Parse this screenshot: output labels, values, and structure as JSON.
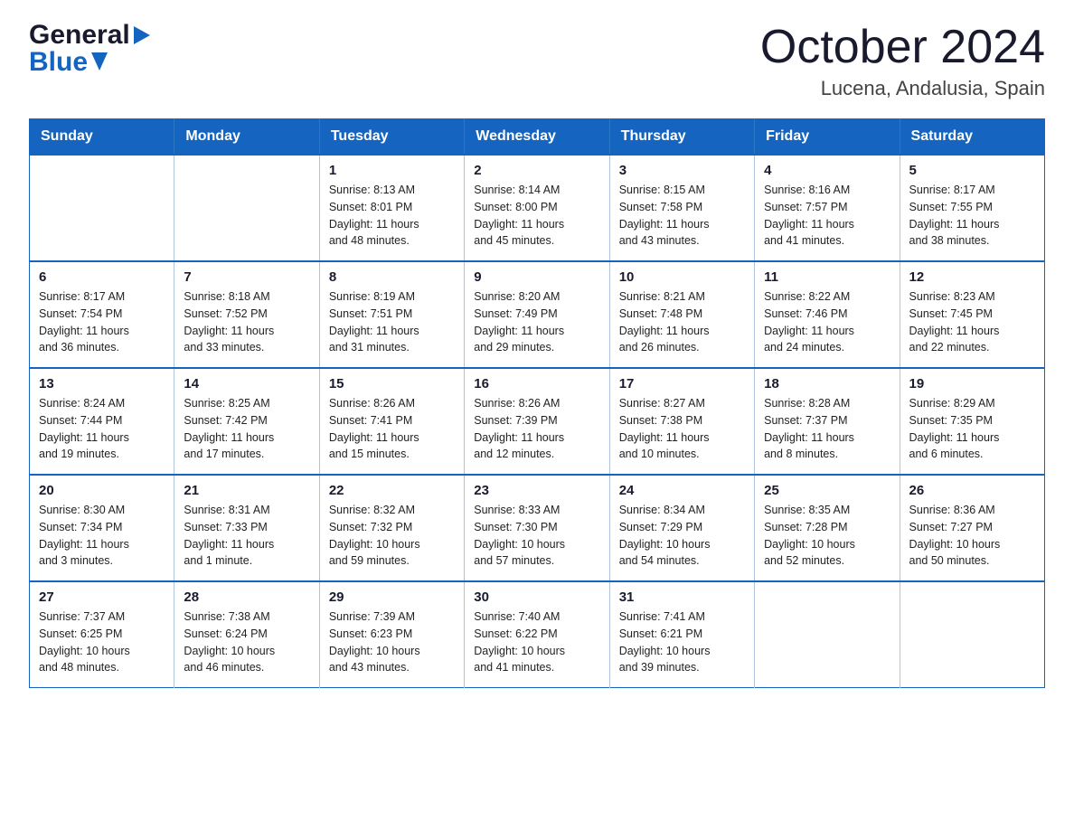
{
  "header": {
    "logo_general": "General",
    "logo_blue": "Blue",
    "month_title": "October 2024",
    "location": "Lucena, Andalusia, Spain"
  },
  "calendar": {
    "days_of_week": [
      "Sunday",
      "Monday",
      "Tuesday",
      "Wednesday",
      "Thursday",
      "Friday",
      "Saturday"
    ],
    "weeks": [
      [
        {
          "day": "",
          "info": ""
        },
        {
          "day": "",
          "info": ""
        },
        {
          "day": "1",
          "info": "Sunrise: 8:13 AM\nSunset: 8:01 PM\nDaylight: 11 hours\nand 48 minutes."
        },
        {
          "day": "2",
          "info": "Sunrise: 8:14 AM\nSunset: 8:00 PM\nDaylight: 11 hours\nand 45 minutes."
        },
        {
          "day": "3",
          "info": "Sunrise: 8:15 AM\nSunset: 7:58 PM\nDaylight: 11 hours\nand 43 minutes."
        },
        {
          "day": "4",
          "info": "Sunrise: 8:16 AM\nSunset: 7:57 PM\nDaylight: 11 hours\nand 41 minutes."
        },
        {
          "day": "5",
          "info": "Sunrise: 8:17 AM\nSunset: 7:55 PM\nDaylight: 11 hours\nand 38 minutes."
        }
      ],
      [
        {
          "day": "6",
          "info": "Sunrise: 8:17 AM\nSunset: 7:54 PM\nDaylight: 11 hours\nand 36 minutes."
        },
        {
          "day": "7",
          "info": "Sunrise: 8:18 AM\nSunset: 7:52 PM\nDaylight: 11 hours\nand 33 minutes."
        },
        {
          "day": "8",
          "info": "Sunrise: 8:19 AM\nSunset: 7:51 PM\nDaylight: 11 hours\nand 31 minutes."
        },
        {
          "day": "9",
          "info": "Sunrise: 8:20 AM\nSunset: 7:49 PM\nDaylight: 11 hours\nand 29 minutes."
        },
        {
          "day": "10",
          "info": "Sunrise: 8:21 AM\nSunset: 7:48 PM\nDaylight: 11 hours\nand 26 minutes."
        },
        {
          "day": "11",
          "info": "Sunrise: 8:22 AM\nSunset: 7:46 PM\nDaylight: 11 hours\nand 24 minutes."
        },
        {
          "day": "12",
          "info": "Sunrise: 8:23 AM\nSunset: 7:45 PM\nDaylight: 11 hours\nand 22 minutes."
        }
      ],
      [
        {
          "day": "13",
          "info": "Sunrise: 8:24 AM\nSunset: 7:44 PM\nDaylight: 11 hours\nand 19 minutes."
        },
        {
          "day": "14",
          "info": "Sunrise: 8:25 AM\nSunset: 7:42 PM\nDaylight: 11 hours\nand 17 minutes."
        },
        {
          "day": "15",
          "info": "Sunrise: 8:26 AM\nSunset: 7:41 PM\nDaylight: 11 hours\nand 15 minutes."
        },
        {
          "day": "16",
          "info": "Sunrise: 8:26 AM\nSunset: 7:39 PM\nDaylight: 11 hours\nand 12 minutes."
        },
        {
          "day": "17",
          "info": "Sunrise: 8:27 AM\nSunset: 7:38 PM\nDaylight: 11 hours\nand 10 minutes."
        },
        {
          "day": "18",
          "info": "Sunrise: 8:28 AM\nSunset: 7:37 PM\nDaylight: 11 hours\nand 8 minutes."
        },
        {
          "day": "19",
          "info": "Sunrise: 8:29 AM\nSunset: 7:35 PM\nDaylight: 11 hours\nand 6 minutes."
        }
      ],
      [
        {
          "day": "20",
          "info": "Sunrise: 8:30 AM\nSunset: 7:34 PM\nDaylight: 11 hours\nand 3 minutes."
        },
        {
          "day": "21",
          "info": "Sunrise: 8:31 AM\nSunset: 7:33 PM\nDaylight: 11 hours\nand 1 minute."
        },
        {
          "day": "22",
          "info": "Sunrise: 8:32 AM\nSunset: 7:32 PM\nDaylight: 10 hours\nand 59 minutes."
        },
        {
          "day": "23",
          "info": "Sunrise: 8:33 AM\nSunset: 7:30 PM\nDaylight: 10 hours\nand 57 minutes."
        },
        {
          "day": "24",
          "info": "Sunrise: 8:34 AM\nSunset: 7:29 PM\nDaylight: 10 hours\nand 54 minutes."
        },
        {
          "day": "25",
          "info": "Sunrise: 8:35 AM\nSunset: 7:28 PM\nDaylight: 10 hours\nand 52 minutes."
        },
        {
          "day": "26",
          "info": "Sunrise: 8:36 AM\nSunset: 7:27 PM\nDaylight: 10 hours\nand 50 minutes."
        }
      ],
      [
        {
          "day": "27",
          "info": "Sunrise: 7:37 AM\nSunset: 6:25 PM\nDaylight: 10 hours\nand 48 minutes."
        },
        {
          "day": "28",
          "info": "Sunrise: 7:38 AM\nSunset: 6:24 PM\nDaylight: 10 hours\nand 46 minutes."
        },
        {
          "day": "29",
          "info": "Sunrise: 7:39 AM\nSunset: 6:23 PM\nDaylight: 10 hours\nand 43 minutes."
        },
        {
          "day": "30",
          "info": "Sunrise: 7:40 AM\nSunset: 6:22 PM\nDaylight: 10 hours\nand 41 minutes."
        },
        {
          "day": "31",
          "info": "Sunrise: 7:41 AM\nSunset: 6:21 PM\nDaylight: 10 hours\nand 39 minutes."
        },
        {
          "day": "",
          "info": ""
        },
        {
          "day": "",
          "info": ""
        }
      ]
    ]
  }
}
